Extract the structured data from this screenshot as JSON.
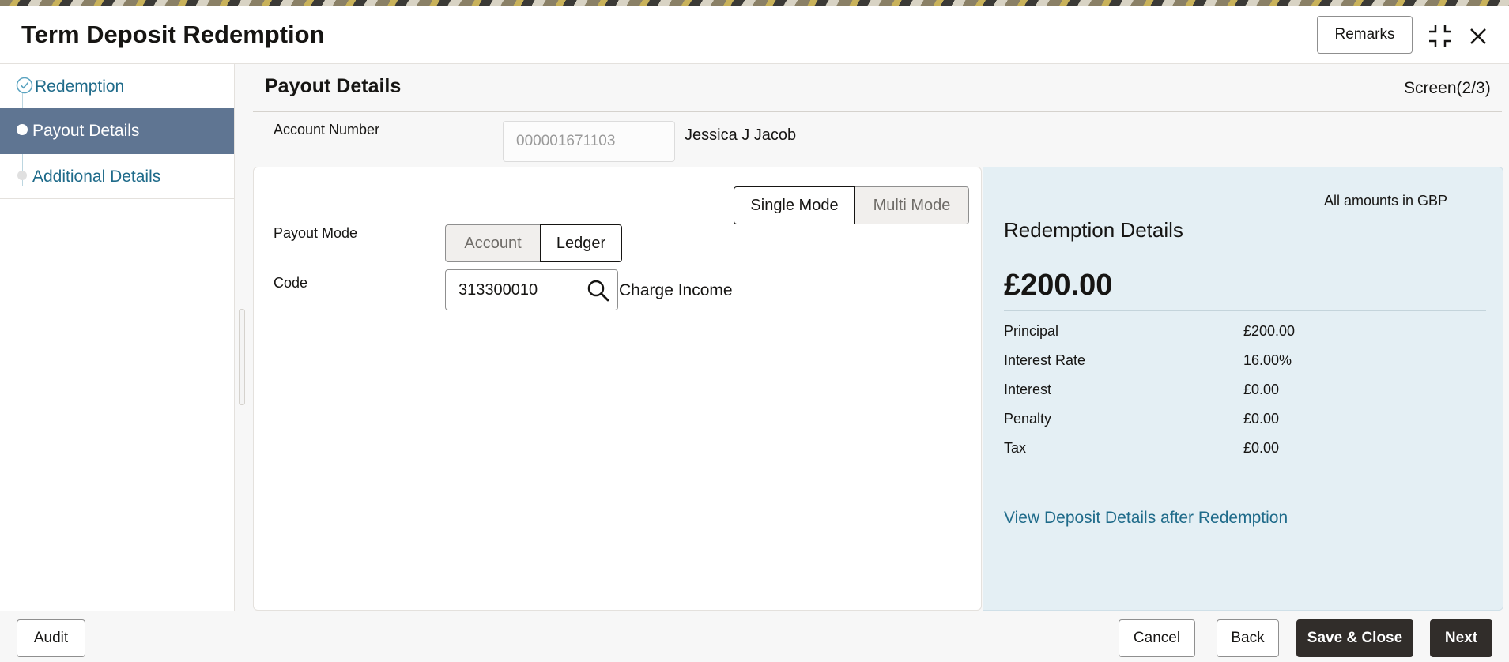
{
  "header": {
    "title": "Term Deposit Redemption",
    "remarks_label": "Remarks"
  },
  "sidebar": {
    "steps": [
      {
        "label": "Redemption",
        "state": "completed"
      },
      {
        "label": "Payout Details",
        "state": "active"
      },
      {
        "label": "Additional Details",
        "state": "pending"
      }
    ]
  },
  "main": {
    "title": "Payout Details",
    "screen_label": "Screen(2/3)",
    "account_number_label": "Account Number",
    "account_number_value": "000001671103",
    "account_name": "Jessica J Jacob",
    "mode_toggle": {
      "single": "Single Mode",
      "multi": "Multi Mode",
      "selected": "single"
    },
    "payout_mode_label": "Payout Mode",
    "payout_mode_options": {
      "account": "Account",
      "ledger": "Ledger",
      "selected": "ledger"
    },
    "code_label": "Code",
    "code_value": "313300010",
    "code_description": "Charge Income"
  },
  "summary": {
    "amounts_note": "All amounts in GBP",
    "title": "Redemption Details",
    "total": "£200.00",
    "rows": [
      {
        "label": "Principal",
        "value": "£200.00"
      },
      {
        "label": "Interest Rate",
        "value": "16.00%"
      },
      {
        "label": "Interest",
        "value": "£0.00"
      },
      {
        "label": "Penalty",
        "value": "£0.00"
      },
      {
        "label": "Tax",
        "value": "£0.00"
      }
    ],
    "link_label": "View Deposit Details after Redemption"
  },
  "footer": {
    "audit": "Audit",
    "cancel": "Cancel",
    "back": "Back",
    "save_close": "Save & Close",
    "next": "Next"
  },
  "colors": {
    "accent": "#1f6b8a",
    "active_step": "#5f7592",
    "summary_bg": "#e4eff4",
    "dark_button": "#312d2a"
  },
  "icons": [
    "minimize-icon",
    "close-icon",
    "search-icon",
    "check-circle-icon",
    "step-dot-icon"
  ]
}
